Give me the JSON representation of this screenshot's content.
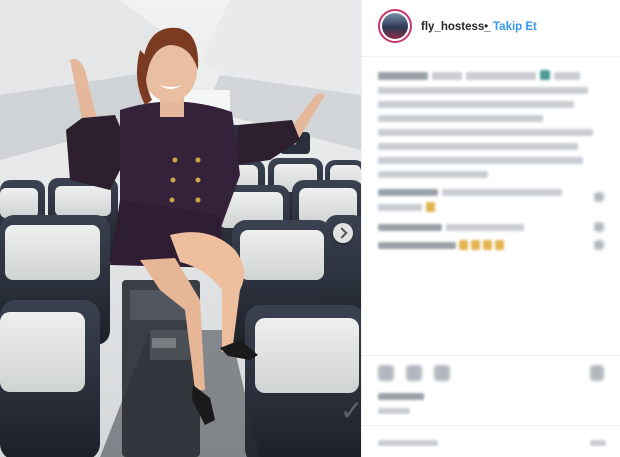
{
  "post": {
    "username": "fly_hostess_",
    "separator": "•",
    "follow_label": "Takip Et"
  },
  "icons": {
    "next": "chevron-right-icon",
    "like": "heart-icon",
    "comment": "comment-icon",
    "share": "share-icon",
    "save": "bookmark-icon"
  },
  "colors": {
    "follow": "#3897f0",
    "avatar_ring": "#c7366f",
    "username": "#262626"
  }
}
